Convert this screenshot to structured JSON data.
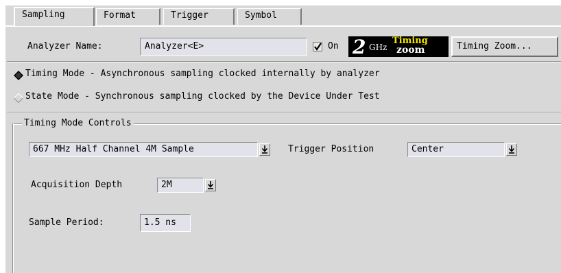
{
  "tabs": [
    {
      "label": "Sampling",
      "active": true
    },
    {
      "label": "Format",
      "active": false
    },
    {
      "label": "Trigger",
      "active": false
    },
    {
      "label": "Symbol",
      "active": false
    }
  ],
  "analyzer": {
    "name_label": "Analyzer Name:",
    "name_value": "Analyzer<E>",
    "on_label": "On",
    "on_checked": true,
    "logo_speed": "2",
    "logo_unit": "GHz",
    "logo_word1": "Timing",
    "logo_word2": "zoom",
    "zoom_button": "Timing Zoom..."
  },
  "modes": {
    "timing": {
      "name": "Timing Mode",
      "desc": "- Asynchronous sampling clocked internally by analyzer",
      "selected": true
    },
    "state": {
      "name": "State Mode",
      "desc": " - Synchronous sampling clocked by the Device Under Test",
      "selected": false
    }
  },
  "controls": {
    "group_title": "Timing Mode Controls",
    "sampling_option": "667 MHz Half Channel 4M Sample",
    "trigger_position_label": "Trigger Position",
    "trigger_position_value": "Center",
    "acq_depth_label": "Acquisition Depth",
    "acq_depth_value": "2M",
    "sample_period_label": "Sample Period:",
    "sample_period_value": "1.5 ns"
  },
  "colors": {
    "panel": "#d8d8d8",
    "field": "#e2e2ea",
    "logo_bg": "#000000",
    "logo_yellow": "#f2e600"
  }
}
